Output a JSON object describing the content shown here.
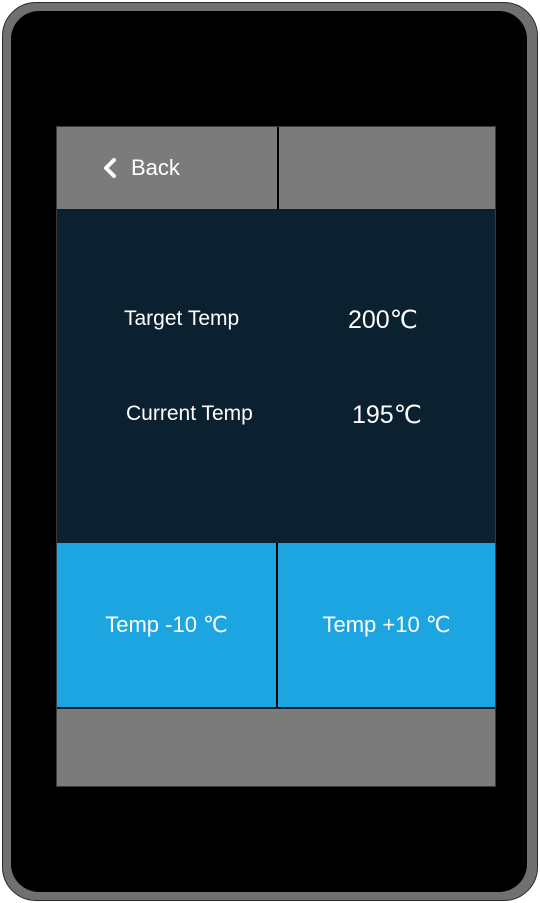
{
  "header": {
    "back_label": "Back",
    "back_icon": "chevron-left-icon"
  },
  "readings": {
    "target_label": "Target Temp",
    "target_value": "200℃",
    "current_label": "Current Temp",
    "current_value": "195℃"
  },
  "controls": {
    "decrease_label": "Temp -10 ℃",
    "increase_label": "Temp +10 ℃"
  },
  "colors": {
    "panel_background": "#0b2130",
    "button_accent": "#1da5e2",
    "bar_gray": "#7b7b7b"
  }
}
